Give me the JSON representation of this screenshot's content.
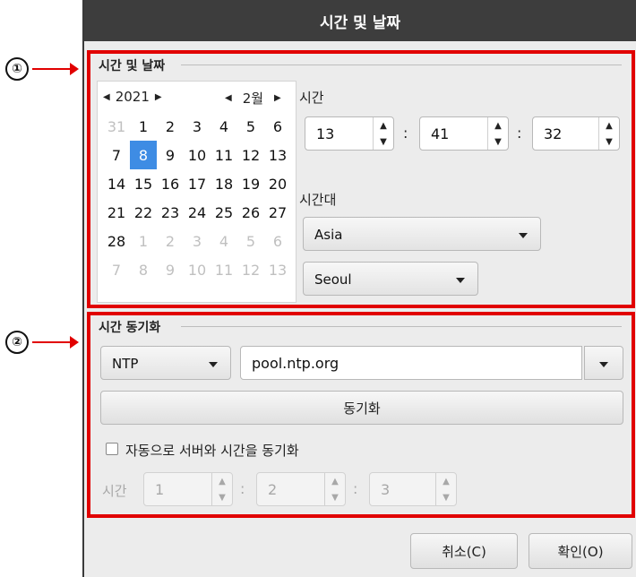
{
  "window": {
    "title": "시간 및 날짜"
  },
  "callouts": [
    "①",
    "②"
  ],
  "datetime": {
    "group_title": "시간 및 날짜",
    "year": "2021",
    "month": "2월",
    "days": [
      {
        "d": "31",
        "state": "dim"
      },
      {
        "d": "1",
        "state": ""
      },
      {
        "d": "2",
        "state": ""
      },
      {
        "d": "3",
        "state": ""
      },
      {
        "d": "4",
        "state": ""
      },
      {
        "d": "5",
        "state": ""
      },
      {
        "d": "6",
        "state": ""
      },
      {
        "d": "7",
        "state": ""
      },
      {
        "d": "8",
        "state": "sel"
      },
      {
        "d": "9",
        "state": ""
      },
      {
        "d": "10",
        "state": ""
      },
      {
        "d": "11",
        "state": ""
      },
      {
        "d": "12",
        "state": ""
      },
      {
        "d": "13",
        "state": ""
      },
      {
        "d": "14",
        "state": ""
      },
      {
        "d": "15",
        "state": ""
      },
      {
        "d": "16",
        "state": ""
      },
      {
        "d": "17",
        "state": ""
      },
      {
        "d": "18",
        "state": ""
      },
      {
        "d": "19",
        "state": ""
      },
      {
        "d": "20",
        "state": ""
      },
      {
        "d": "21",
        "state": ""
      },
      {
        "d": "22",
        "state": ""
      },
      {
        "d": "23",
        "state": ""
      },
      {
        "d": "24",
        "state": ""
      },
      {
        "d": "25",
        "state": ""
      },
      {
        "d": "26",
        "state": ""
      },
      {
        "d": "27",
        "state": ""
      },
      {
        "d": "28",
        "state": ""
      },
      {
        "d": "1",
        "state": "dim"
      },
      {
        "d": "2",
        "state": "dim"
      },
      {
        "d": "3",
        "state": "dim"
      },
      {
        "d": "4",
        "state": "dim"
      },
      {
        "d": "5",
        "state": "dim"
      },
      {
        "d": "6",
        "state": "dim"
      },
      {
        "d": "7",
        "state": "dim"
      },
      {
        "d": "8",
        "state": "dim"
      },
      {
        "d": "9",
        "state": "dim"
      },
      {
        "d": "10",
        "state": "dim"
      },
      {
        "d": "11",
        "state": "dim"
      },
      {
        "d": "12",
        "state": "dim"
      },
      {
        "d": "13",
        "state": "dim"
      }
    ],
    "time_label": "시간",
    "hour": "13",
    "minute": "41",
    "second": "32",
    "separator": ":",
    "timezone_label": "시간대",
    "region": "Asia",
    "city": "Seoul"
  },
  "sync": {
    "group_title": "시간 동기화",
    "protocol": "NTP",
    "server": "pool.ntp.org",
    "sync_button": "동기화",
    "auto_label": "자동으로 서버와 시간을 동기화",
    "interval_label": "시간",
    "interval_h": "1",
    "interval_m": "2",
    "interval_s": "3"
  },
  "buttons": {
    "cancel": "취소(C)",
    "ok": "확인(O)"
  },
  "colors": {
    "highlight": "#e10000",
    "selected_day": "#3e8ce4",
    "titlebar": "#3d3d3d"
  }
}
